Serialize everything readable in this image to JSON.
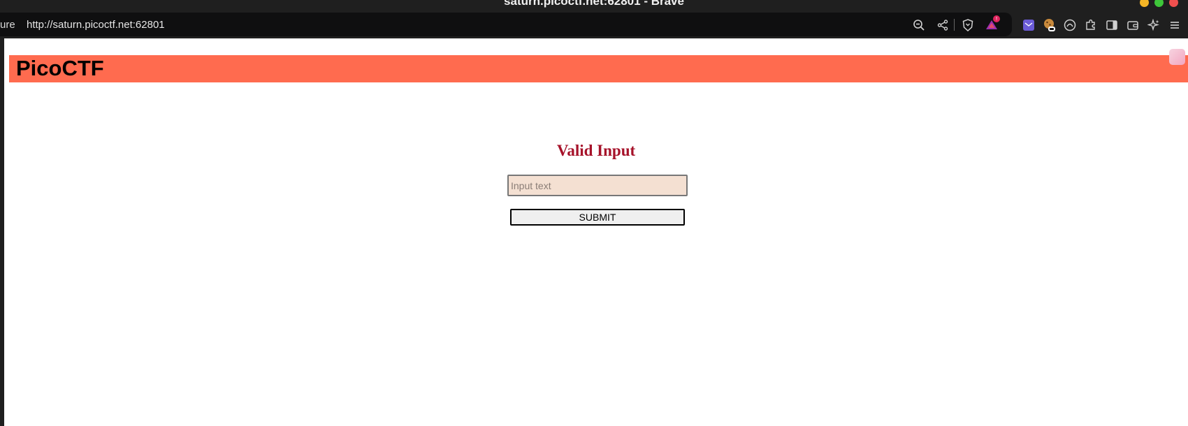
{
  "window": {
    "title": "saturn.picoctf.net:62801 - Brave"
  },
  "address_bar": {
    "prefix_text": "ure",
    "url": "http://saturn.picoctf.net:62801"
  },
  "toolbar_icons": [
    "zoom-out-icon",
    "share-icon",
    "brave-shields-icon",
    "brave-rewards-icon",
    "extension-mail-icon",
    "extension-cookie-icon",
    "extension-helmet-icon",
    "extensions-puzzle-icon",
    "sidebar-icon",
    "wallet-icon",
    "leo-ai-icon",
    "menu-icon"
  ],
  "rewards_badge": "!",
  "page": {
    "brand": "PicoCTF",
    "header_color": "#ff6b4f",
    "form_title": "Valid Input",
    "title_color": "#a6122a",
    "input": {
      "placeholder": "Input text",
      "value": ""
    },
    "submit_label": "SUBMIT"
  }
}
